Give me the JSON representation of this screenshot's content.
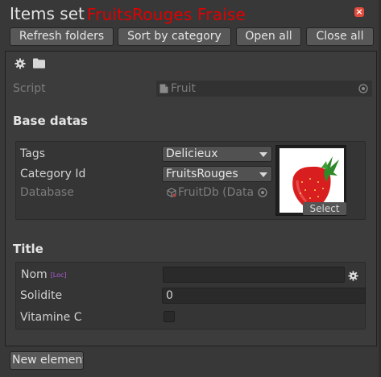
{
  "window": {
    "title": "Items set"
  },
  "toolbar": {
    "refresh_label": "Refresh folders",
    "sort_label": "Sort by category",
    "open_all_label": "Open all",
    "close_all_label": "Close all"
  },
  "item": {
    "header_name": "FruitsRouges  Fraise",
    "header_color": "#e00000",
    "script": {
      "label": "Script",
      "value": "Fruit"
    },
    "base_section": {
      "title": "Base datas",
      "tags": {
        "label": "Tags",
        "value": "Delicieux"
      },
      "category": {
        "label": "Category Id",
        "value": "FruitsRouges"
      },
      "database": {
        "label": "Database",
        "value": "FruitDb (Data"
      },
      "preview": {
        "select_label": "Select",
        "image": "strawberry-image"
      }
    },
    "title_section": {
      "title": "Title",
      "nom": {
        "label": "Nom",
        "loc_tag": "[Loc]",
        "value": ""
      },
      "solidite": {
        "label": "Solidite",
        "value": "0"
      },
      "vitamine": {
        "label": "Vitamine C",
        "checked": false
      }
    }
  },
  "footer": {
    "new_element_label": "New element"
  },
  "icons": [
    "gear-icon",
    "folder-icon",
    "close-icon",
    "script-file-icon",
    "object-picker-icon",
    "scriptable-object-icon"
  ]
}
